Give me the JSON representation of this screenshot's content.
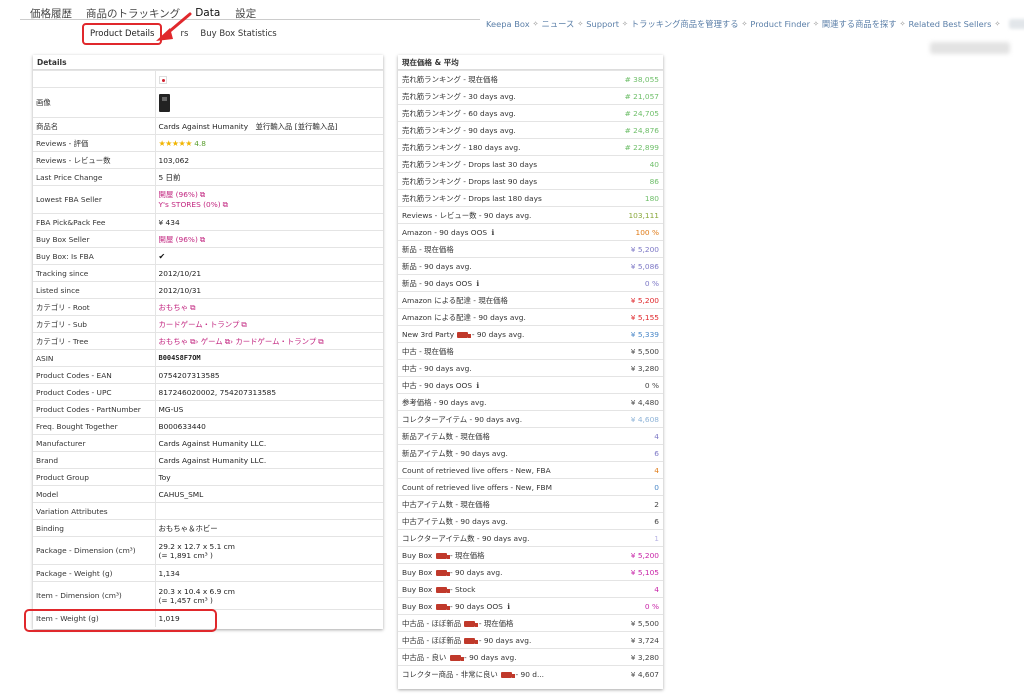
{
  "top_tabs": {
    "history": "価格履歴",
    "tracking": "商品のトラッキング",
    "data": "Data",
    "settings": "設定"
  },
  "sub_tabs": {
    "product_details": "Product Details",
    "other_fragment": "rs",
    "buy_box": "Buy Box Statistics"
  },
  "nav": {
    "items": [
      "Keepa Box",
      "ニュース",
      "Support",
      "トラッキング商品を管理する",
      "Product Finder",
      "関連する商品を探す",
      "Related Best Sellers"
    ],
    "sep": "✧"
  },
  "details": {
    "title": "Details",
    "rows": {
      "image": "画像",
      "name_k": "商品名",
      "name_v": "Cards Against Humanity　並行輸入品 [並行輸入品]",
      "rating_k": "Reviews - 評価",
      "rating_stars": "★★★★★",
      "rating_v": "4.8",
      "reviews_k": "Reviews - レビュー数",
      "reviews_v": "103,062",
      "lpc_k": "Last Price Change",
      "lpc_v": "5 日前",
      "lfba_k": "Lowest FBA Seller",
      "lfba_v1": "開屋 (96%)",
      "lfba_v2": "Y's STORES (0%)",
      "fee_k": "FBA Pick&Pack Fee",
      "fee_v": "¥ 434",
      "bbs_k": "Buy Box Seller",
      "bbs_v": "開屋 (96%)",
      "bbfba_k": "Buy Box: Is FBA",
      "bbfba_v": "✔",
      "ts_k": "Tracking since",
      "ts_v": "2012/10/21",
      "ls_k": "Listed since",
      "ls_v": "2012/10/31",
      "root_k": "カテゴリ - Root",
      "root_v": "おもちゃ",
      "sub_k": "カテゴリ - Sub",
      "sub_v": "カードゲーム・トランプ",
      "tree_k": "カテゴリ - Tree",
      "tree_v1": "おもちゃ",
      "tree_v2": "› ゲーム",
      "tree_v3": "› カードゲーム・トランプ",
      "asin_k": "ASIN",
      "asin_v": "B004S8F7OM",
      "ean_k": "Product Codes - EAN",
      "ean_v": "0754207313585",
      "upc_k": "Product Codes - UPC",
      "upc_v": "817246020002, 754207313585",
      "pn_k": "Product Codes - PartNumber",
      "pn_v": "MG-US",
      "fbt_k": "Freq. Bought Together",
      "fbt_v": "B000633440",
      "mfr_k": "Manufacturer",
      "mfr_v": "Cards Against Humanity LLC.",
      "brand_k": "Brand",
      "brand_v": "Cards Against Humanity LLC.",
      "pg_k": "Product Group",
      "pg_v": "Toy",
      "model_k": "Model",
      "model_v": "CAHUS_SML",
      "var_k": "Variation Attributes",
      "var_v": "",
      "binding_k": "Binding",
      "binding_v": "おもちゃ＆ホビー",
      "pkgdim_k": "Package - Dimension (cm³)",
      "pkgdim_v1": "29.2 x 12.7 x 5.1 cm",
      "pkgdim_v2": "(= 1,891 cm³ )",
      "pkgw_k": "Package - Weight (g)",
      "pkgw_v": "1,134",
      "itemdim_k": "Item - Dimension (cm³)",
      "itemdim_v1": "20.3 x 10.4 x 6.9 cm",
      "itemdim_v2": "(= 1,457 cm³ )",
      "itemw_k": "Item - Weight (g)",
      "itemw_v": "1,019"
    }
  },
  "stats": {
    "title": "現在価格 & 平均",
    "rows": [
      {
        "label": "売れ筋ランキング - 現在価格",
        "value": "# 38,055",
        "color": "c-green"
      },
      {
        "label": "売れ筋ランキング - 30 days avg.",
        "value": "# 21,057",
        "color": "c-green"
      },
      {
        "label": "売れ筋ランキング - 60 days avg.",
        "value": "# 24,705",
        "color": "c-green"
      },
      {
        "label": "売れ筋ランキング - 90 days avg.",
        "value": "# 24,876",
        "color": "c-green"
      },
      {
        "label": "売れ筋ランキング - 180 days avg.",
        "value": "# 22,899",
        "color": "c-green"
      },
      {
        "label": "売れ筋ランキング - Drops last 30 days",
        "value": "40",
        "color": "c-green"
      },
      {
        "label": "売れ筋ランキング - Drops last 90 days",
        "value": "86",
        "color": "c-green"
      },
      {
        "label": "売れ筋ランキング - Drops last 180 days",
        "value": "180",
        "color": "c-green"
      },
      {
        "label": "Reviews - レビュー数 - 90 days avg.",
        "value": "103,111",
        "color": "c-olive"
      },
      {
        "label": "Amazon - 90 days OOS",
        "value": "100 %",
        "color": "c-orange",
        "info": "ℹ"
      },
      {
        "label": "新品 - 現在価格",
        "value": "¥ 5,200",
        "color": "c-purple"
      },
      {
        "label": "新品 - 90 days avg.",
        "value": "¥ 5,086",
        "color": "c-purple"
      },
      {
        "label": "新品 - 90 days OOS",
        "value": "0 %",
        "color": "c-purple",
        "info": "ℹ"
      },
      {
        "label": "Amazon による配達 - 現在価格",
        "value": "¥ 5,200",
        "color": "c-red"
      },
      {
        "label": "Amazon による配達 - 90 days avg.",
        "value": "¥ 5,155",
        "color": "c-red"
      },
      {
        "label": "New 3rd Party",
        "label2": "- 90 days avg.",
        "truck": true,
        "value": "¥ 5,339",
        "color": "c-blue"
      },
      {
        "label": "中古 - 現在価格",
        "value": "¥ 5,500",
        "color": "c-grey"
      },
      {
        "label": "中古 - 90 days avg.",
        "value": "¥ 3,280",
        "color": "c-grey"
      },
      {
        "label": "中古 - 90 days OOS",
        "value": "0 %",
        "color": "c-grey",
        "info": "ℹ"
      },
      {
        "label": "参考価格 - 90 days avg.",
        "value": "¥ 4,480",
        "color": "c-grey"
      },
      {
        "label": "コレクターアイテム - 90 days avg.",
        "value": "¥ 4,608",
        "color": "c-lightblue"
      },
      {
        "label": "新品アイテム数 - 現在価格",
        "value": "4",
        "color": "c-purple"
      },
      {
        "label": "新品アイテム数 - 90 days avg.",
        "value": "6",
        "color": "c-purple"
      },
      {
        "label": "Count of retrieved live offers - New, FBA",
        "value": "4",
        "color": "c-orange"
      },
      {
        "label": "Count of retrieved live offers - New, FBM",
        "value": "0",
        "color": "c-blue"
      },
      {
        "label": "中古アイテム数 - 現在価格",
        "value": "2",
        "color": "c-grey"
      },
      {
        "label": "中古アイテム数 - 90 days avg.",
        "value": "6",
        "color": "c-grey"
      },
      {
        "label": "コレクターアイテム数 - 90 days avg.",
        "value": "1",
        "color": "c-lightpurple"
      },
      {
        "label": "Buy Box",
        "label2": "- 現在価格",
        "truck": true,
        "value": "¥ 5,200",
        "color": "c-magenta"
      },
      {
        "label": "Buy Box",
        "label2": "- 90 days avg.",
        "truck": true,
        "value": "¥ 5,105",
        "color": "c-magenta"
      },
      {
        "label": "Buy Box",
        "label2": "- Stock",
        "truck": true,
        "value": "4",
        "color": "c-magenta"
      },
      {
        "label": "Buy Box",
        "label2": "- 90 days OOS",
        "truck": true,
        "value": "0 %",
        "color": "c-magenta",
        "info": "ℹ"
      },
      {
        "label": "中古品 - ほぼ新品",
        "label2": "- 現在価格",
        "truck": true,
        "value": "¥ 5,500",
        "color": "c-grey"
      },
      {
        "label": "中古品 - ほぼ新品",
        "label2": "- 90 days avg.",
        "truck": true,
        "value": "¥ 3,724",
        "color": "c-grey"
      },
      {
        "label": "中古品 - 良い",
        "label2": "- 90 days avg.",
        "truck": true,
        "value": "¥ 3,280",
        "color": "c-grey"
      },
      {
        "label": "コレクター商品 - 非常に良い",
        "label2": "- 90 d...",
        "truck": true,
        "value": "¥ 4,607",
        "color": "c-grey"
      }
    ]
  }
}
